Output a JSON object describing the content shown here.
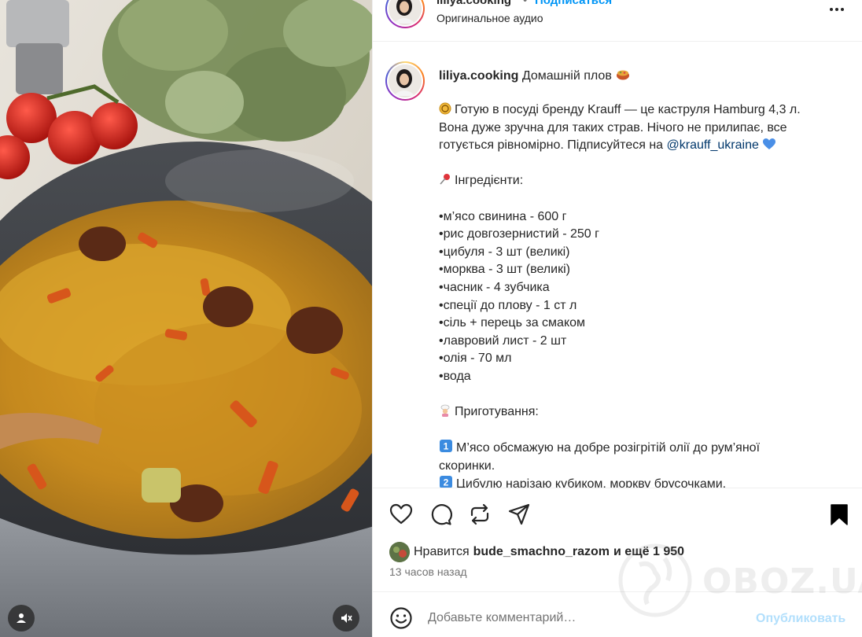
{
  "header": {
    "username": "liliya.cooking",
    "separator": "•",
    "follow_label": "Подписаться",
    "audio_label": "Оригинальное аудио"
  },
  "caption": {
    "username": "liliya.cooking",
    "title": "Домашній плов",
    "lines": [
      {
        "text": "Готую в посуді бренду Krauff — це каструля Hamburg 4,3 л.",
        "emoji": "coin"
      },
      {
        "text": "Вона дуже зручна для таких страв. Нічого не прилипає, все"
      },
      {
        "text": "готується рівномірно. Підписуйтеся на "
      },
      {
        "text": ""
      },
      {
        "text": "Інгредієнти:",
        "emoji": "pin"
      },
      {
        "text": ""
      },
      {
        "text": "•м’ясо свинина - 600 г"
      },
      {
        "text": "•рис довгозернистий - 250 г"
      },
      {
        "text": "•цибуля - 3 шт (великі)"
      },
      {
        "text": "•морква - 3 шт (великі)"
      },
      {
        "text": "•часник - 4 зубчика"
      },
      {
        "text": "•спеції до плову - 1 ст л"
      },
      {
        "text": "•сіль + перець за смаком"
      },
      {
        "text": "•лавровий лист - 2 шт"
      },
      {
        "text": "•олія - 70 мл"
      },
      {
        "text": "•вода"
      },
      {
        "text": ""
      },
      {
        "text": "Приготування:",
        "emoji": "cook"
      },
      {
        "text": ""
      },
      {
        "text": "М’ясо обсмажую на добре розігрітій олії до рум’яної",
        "emoji": "key1"
      },
      {
        "text": "скоринки."
      },
      {
        "text": "Цибулю нарізаю кубиком, моркву брусочками.",
        "emoji": "key2"
      }
    ],
    "mention": "@krauff_ukraine"
  },
  "likes": {
    "prefix": "Нравится",
    "user": "bude_smachno_razom",
    "suffix": "и ещё 1 950"
  },
  "time_ago": "13 часов назад",
  "comment": {
    "placeholder": "Добавьте комментарий…",
    "post_label": "Опубликовать"
  },
  "watermark": "OBOZ.UA",
  "colors": {
    "link": "#0095f6",
    "mention": "#00376b",
    "post_disabled": "#b2dffc",
    "muted_text": "#737373"
  },
  "icons": [
    "heart-icon",
    "comment-icon",
    "repost-icon",
    "share-icon",
    "bookmark-icon",
    "emoji-icon",
    "more-icon",
    "user-tag-icon",
    "mute-icon"
  ]
}
